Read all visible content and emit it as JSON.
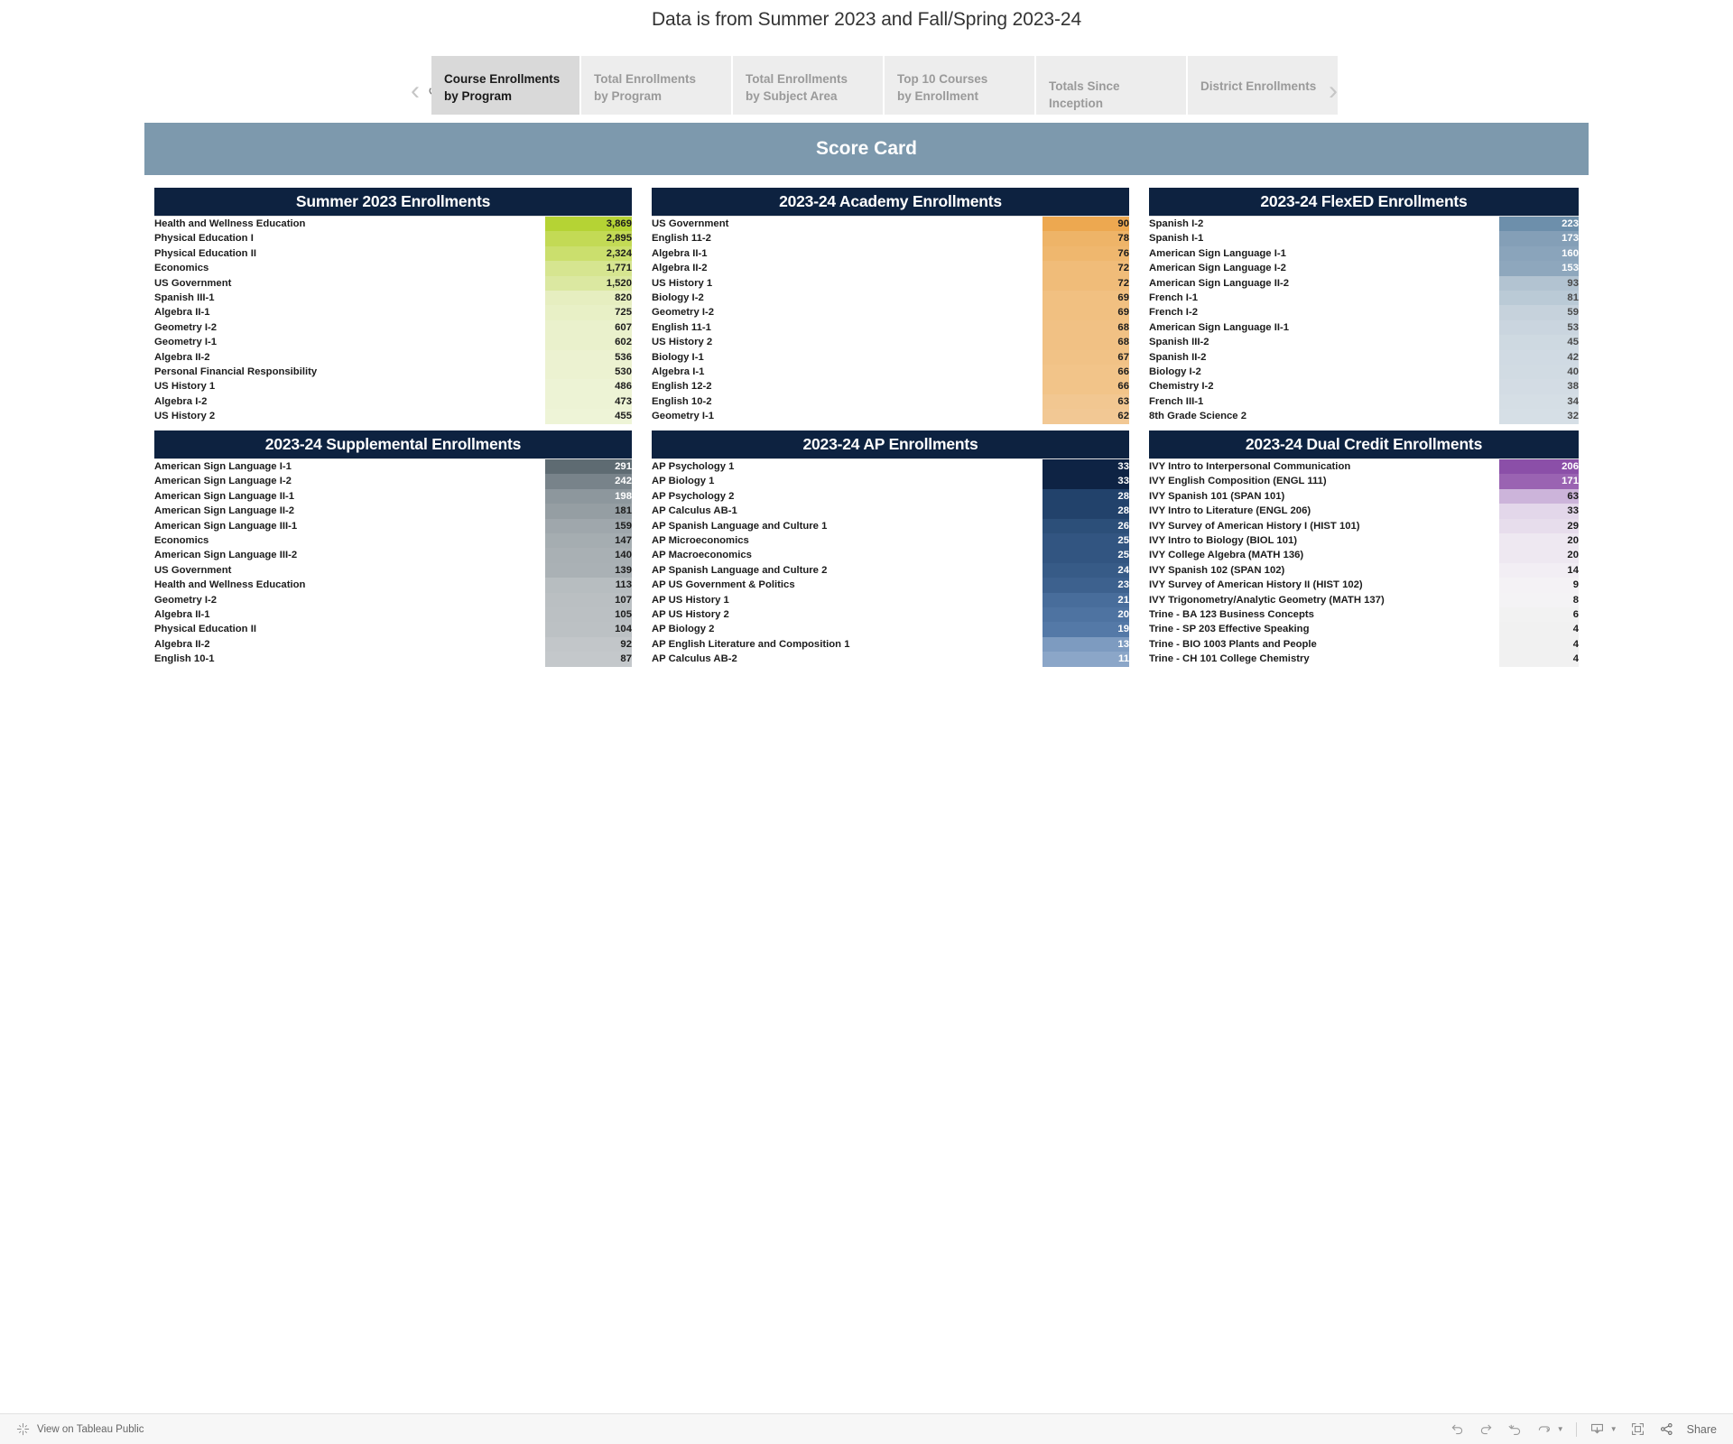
{
  "page": {
    "title": "Data is from Summer 2023 and Fall/Spring 2023-24",
    "scorecard_banner": "Score Card"
  },
  "tabs": {
    "prev_label": "‹",
    "next_label": "›",
    "revert_label": "↺",
    "items": [
      {
        "label": "Course Enrollments\nby Program",
        "active": true
      },
      {
        "label": "Total Enrollments\nby Program",
        "active": false
      },
      {
        "label": "Total Enrollments\nby Subject Area",
        "active": false
      },
      {
        "label": "Top 10 Courses\nby Enrollment",
        "active": false
      },
      {
        "label": "Totals Since Inception",
        "active": false
      },
      {
        "label": "District Enrollments",
        "active": false
      }
    ]
  },
  "colors": {
    "header_navy": "#0d2240",
    "banner_blue": "#7d99ad",
    "green_accent": "#b5d334",
    "orange_accent": "#eda850",
    "steel_blue_accent": "#6d8fab",
    "gray_accent": "#5e6b72",
    "ap_blue_accent": "#0e2344",
    "purple_accent": "#8b4fa8"
  },
  "panels": [
    {
      "title": "Summer 2023 Enrollments",
      "scheme": "green",
      "rows": [
        {
          "label": "Health and Wellness Education",
          "value": "3,869",
          "n": 3869,
          "color": "#b5d334",
          "text": "#1c1c1c"
        },
        {
          "label": "Physical Education I",
          "value": "2,895",
          "n": 2895,
          "color": "#c3da55",
          "text": "#1c1c1c"
        },
        {
          "label": "Physical Education II",
          "value": "2,324",
          "n": 2324,
          "color": "#cbdf6d",
          "text": "#1c1c1c"
        },
        {
          "label": "Economics",
          "value": "1,771",
          "n": 1771,
          "color": "#d6e590",
          "text": "#1c1c1c"
        },
        {
          "label": "US Government",
          "value": "1,520",
          "n": 1520,
          "color": "#dbe8a1",
          "text": "#1c1c1c"
        },
        {
          "label": "Spanish III-1",
          "value": "820",
          "n": 820,
          "color": "#e6eec0",
          "text": "#1c1c1c"
        },
        {
          "label": "Algebra II-1",
          "value": "725",
          "n": 725,
          "color": "#e8f0c6",
          "text": "#1c1c1c"
        },
        {
          "label": "Geometry I-2",
          "value": "607",
          "n": 607,
          "color": "#eaf1cc",
          "text": "#1c1c1c"
        },
        {
          "label": "Geometry I-1",
          "value": "602",
          "n": 602,
          "color": "#eaf1cc",
          "text": "#1c1c1c"
        },
        {
          "label": "Algebra II-2",
          "value": "536",
          "n": 536,
          "color": "#ecf2d1",
          "text": "#1c1c1c"
        },
        {
          "label": "Personal Financial Responsibility",
          "value": "530",
          "n": 530,
          "color": "#ecf2d1",
          "text": "#1c1c1c"
        },
        {
          "label": "US History 1",
          "value": "486",
          "n": 486,
          "color": "#edf3d5",
          "text": "#1c1c1c"
        },
        {
          "label": "Algebra I-2",
          "value": "473",
          "n": 473,
          "color": "#edf3d5",
          "text": "#1c1c1c"
        },
        {
          "label": "US History 2",
          "value": "455",
          "n": 455,
          "color": "#eef4d7",
          "text": "#1c1c1c"
        }
      ]
    },
    {
      "title": "2023-24 Academy Enrollments",
      "scheme": "orange",
      "rows": [
        {
          "label": "US Government",
          "value": "90",
          "n": 90,
          "color": "#eda850",
          "text": "#1c1c1c"
        },
        {
          "label": "English 11-2",
          "value": "78",
          "n": 78,
          "color": "#eeb468",
          "text": "#1c1c1c"
        },
        {
          "label": "Algebra II-1",
          "value": "76",
          "n": 76,
          "color": "#efb76e",
          "text": "#1c1c1c"
        },
        {
          "label": "Algebra II-2",
          "value": "72",
          "n": 72,
          "color": "#f0bc79",
          "text": "#1c1c1c"
        },
        {
          "label": "US History 1",
          "value": "72",
          "n": 72,
          "color": "#f0bc79",
          "text": "#1c1c1c"
        },
        {
          "label": "Biology I-2",
          "value": "69",
          "n": 69,
          "color": "#f1c081",
          "text": "#1c1c1c"
        },
        {
          "label": "Geometry I-2",
          "value": "69",
          "n": 69,
          "color": "#f1c081",
          "text": "#1c1c1c"
        },
        {
          "label": "English 11-1",
          "value": "68",
          "n": 68,
          "color": "#f1c184",
          "text": "#1c1c1c"
        },
        {
          "label": "US History 2",
          "value": "68",
          "n": 68,
          "color": "#f1c184",
          "text": "#1c1c1c"
        },
        {
          "label": "Biology I-1",
          "value": "67",
          "n": 67,
          "color": "#f1c286",
          "text": "#1c1c1c"
        },
        {
          "label": "Algebra I-1",
          "value": "66",
          "n": 66,
          "color": "#f2c489",
          "text": "#1c1c1c"
        },
        {
          "label": "English 12-2",
          "value": "66",
          "n": 66,
          "color": "#f2c489",
          "text": "#1c1c1c"
        },
        {
          "label": "English 10-2",
          "value": "63",
          "n": 63,
          "color": "#f2c791",
          "text": "#1c1c1c"
        },
        {
          "label": "Geometry I-1",
          "value": "62",
          "n": 62,
          "color": "#f2c894",
          "text": "#1c1c1c"
        }
      ]
    },
    {
      "title": "2023-24 FlexED Enrollments",
      "scheme": "steelblue",
      "rows": [
        {
          "label": "Spanish I-2",
          "value": "223",
          "n": 223,
          "color": "#6d8fab",
          "text": "#ffffff"
        },
        {
          "label": "Spanish I-1",
          "value": "173",
          "n": 173,
          "color": "#849fb7",
          "text": "#ffffff"
        },
        {
          "label": "American Sign Language I-1",
          "value": "160",
          "n": 160,
          "color": "#8aa4bb",
          "text": "#ffffff"
        },
        {
          "label": "American Sign Language I-2",
          "value": "153",
          "n": 153,
          "color": "#8ea7bd",
          "text": "#ffffff"
        },
        {
          "label": "American Sign Language II-2",
          "value": "93",
          "n": 93,
          "color": "#b2c3d1",
          "text": "#4a4a4a"
        },
        {
          "label": "French I-1",
          "value": "81",
          "n": 81,
          "color": "#bacad6",
          "text": "#4a4a4a"
        },
        {
          "label": "French I-2",
          "value": "59",
          "n": 59,
          "color": "#c6d2dc",
          "text": "#4a4a4a"
        },
        {
          "label": "American Sign Language II-1",
          "value": "53",
          "n": 53,
          "color": "#cad5df",
          "text": "#4a4a4a"
        },
        {
          "label": "Spanish III-2",
          "value": "45",
          "n": 45,
          "color": "#ced9e1",
          "text": "#4a4a4a"
        },
        {
          "label": "Spanish II-2",
          "value": "42",
          "n": 42,
          "color": "#d0dae3",
          "text": "#4a4a4a"
        },
        {
          "label": "Biology I-2",
          "value": "40",
          "n": 40,
          "color": "#d1dbe3",
          "text": "#4a4a4a"
        },
        {
          "label": "Chemistry I-2",
          "value": "38",
          "n": 38,
          "color": "#d3dce4",
          "text": "#4a4a4a"
        },
        {
          "label": "French III-1",
          "value": "34",
          "n": 34,
          "color": "#d5dee5",
          "text": "#4a4a4a"
        },
        {
          "label": "8th Grade Science 2",
          "value": "32",
          "n": 32,
          "color": "#d6dfe6",
          "text": "#4a4a4a"
        }
      ]
    },
    {
      "title": "2023-24 Supplemental Enrollments",
      "scheme": "gray",
      "rows": [
        {
          "label": "American Sign Language I-1",
          "value": "291",
          "n": 291,
          "color": "#5e6b72",
          "text": "#ffffff"
        },
        {
          "label": "American Sign Language I-2",
          "value": "242",
          "n": 242,
          "color": "#78838a",
          "text": "#ffffff"
        },
        {
          "label": "American Sign Language II-1",
          "value": "198",
          "n": 198,
          "color": "#8d979d",
          "text": "#ffffff"
        },
        {
          "label": "American Sign Language II-2",
          "value": "181",
          "n": 181,
          "color": "#959ea3",
          "text": "#1c1c1c"
        },
        {
          "label": "American Sign Language III-1",
          "value": "159",
          "n": 159,
          "color": "#9fa7ac",
          "text": "#1c1c1c"
        },
        {
          "label": "Economics",
          "value": "147",
          "n": 147,
          "color": "#a5adb1",
          "text": "#1c1c1c"
        },
        {
          "label": "American Sign Language III-2",
          "value": "140",
          "n": 140,
          "color": "#a9b0b4",
          "text": "#1c1c1c"
        },
        {
          "label": "US Government",
          "value": "139",
          "n": 139,
          "color": "#aab1b5",
          "text": "#1c1c1c"
        },
        {
          "label": "Health and Wellness Education",
          "value": "113",
          "n": 113,
          "color": "#b7bdc0",
          "text": "#1c1c1c"
        },
        {
          "label": "Geometry I-2",
          "value": "107",
          "n": 107,
          "color": "#babfc2",
          "text": "#1c1c1c"
        },
        {
          "label": "Algebra II-1",
          "value": "105",
          "n": 105,
          "color": "#bbc0c3",
          "text": "#1c1c1c"
        },
        {
          "label": "Physical Education II",
          "value": "104",
          "n": 104,
          "color": "#bcc1c4",
          "text": "#1c1c1c"
        },
        {
          "label": "Algebra II-2",
          "value": "92",
          "n": 92,
          "color": "#c2c6c9",
          "text": "#1c1c1c"
        },
        {
          "label": "English 10-1",
          "value": "87",
          "n": 87,
          "color": "#c4c8cb",
          "text": "#1c1c1c"
        }
      ]
    },
    {
      "title": "2023-24 AP Enrollments",
      "scheme": "apblue",
      "rows": [
        {
          "label": "AP Psychology 1",
          "value": "33",
          "n": 33,
          "color": "#0e2344",
          "text": "#ffffff"
        },
        {
          "label": "AP Biology 1",
          "value": "33",
          "n": 33,
          "color": "#0e2344",
          "text": "#ffffff"
        },
        {
          "label": "AP Psychology 2",
          "value": "28",
          "n": 28,
          "color": "#22426b",
          "text": "#ffffff"
        },
        {
          "label": "AP Calculus AB-1",
          "value": "28",
          "n": 28,
          "color": "#22426b",
          "text": "#ffffff"
        },
        {
          "label": "AP Spanish Language and Culture 1",
          "value": "26",
          "n": 26,
          "color": "#2c4f79",
          "text": "#ffffff"
        },
        {
          "label": "AP Microeconomics",
          "value": "25",
          "n": 25,
          "color": "#325581",
          "text": "#ffffff"
        },
        {
          "label": "AP Macroeconomics",
          "value": "25",
          "n": 25,
          "color": "#325581",
          "text": "#ffffff"
        },
        {
          "label": "AP Spanish Language and Culture 2",
          "value": "24",
          "n": 24,
          "color": "#375b87",
          "text": "#ffffff"
        },
        {
          "label": "AP US Government & Politics",
          "value": "23",
          "n": 23,
          "color": "#3d618e",
          "text": "#ffffff"
        },
        {
          "label": "AP US History 1",
          "value": "21",
          "n": 21,
          "color": "#486d9b",
          "text": "#ffffff"
        },
        {
          "label": "AP US History 2",
          "value": "20",
          "n": 20,
          "color": "#4e73a1",
          "text": "#ffffff"
        },
        {
          "label": "AP Biology 2",
          "value": "19",
          "n": 19,
          "color": "#5479a7",
          "text": "#ffffff"
        },
        {
          "label": "AP English Literature and Composition 1",
          "value": "13",
          "n": 13,
          "color": "#7d9bc0",
          "text": "#ffffff"
        },
        {
          "label": "AP Calculus AB-2",
          "value": "11",
          "n": 11,
          "color": "#8ba6c8",
          "text": "#ffffff"
        }
      ]
    },
    {
      "title": "2023-24 Dual Credit Enrollments",
      "scheme": "purple",
      "rows": [
        {
          "label": "IVY Intro to Interpersonal Communication",
          "value": "206",
          "n": 206,
          "color": "#8b4fa8",
          "text": "#ffffff"
        },
        {
          "label": "IVY English Composition (ENGL 111)",
          "value": "171",
          "n": 171,
          "color": "#9a63b2",
          "text": "#ffffff"
        },
        {
          "label": "IVY Spanish 101 (SPAN 101)",
          "value": "63",
          "n": 63,
          "color": "#ccb4da",
          "text": "#1c1c1c"
        },
        {
          "label": "IVY Intro to Literature (ENGL 206)",
          "value": "33",
          "n": 33,
          "color": "#e3d7ea",
          "text": "#1c1c1c"
        },
        {
          "label": "IVY Survey of American History I (HIST 101)",
          "value": "29",
          "n": 29,
          "color": "#e7ddec",
          "text": "#1c1c1c"
        },
        {
          "label": "IVY Intro to Biology (BIOL 101)",
          "value": "20",
          "n": 20,
          "color": "#eee8f1",
          "text": "#1c1c1c"
        },
        {
          "label": "IVY College Algebra (MATH 136)",
          "value": "20",
          "n": 20,
          "color": "#eee8f1",
          "text": "#1c1c1c"
        },
        {
          "label": "IVY Spanish 102 (SPAN 102)",
          "value": "14",
          "n": 14,
          "color": "#f2eef4",
          "text": "#1c1c1c"
        },
        {
          "label": "IVY Survey of American History II (HIST 102)",
          "value": "9",
          "n": 9,
          "color": "#f4f2f5",
          "text": "#1c1c1c"
        },
        {
          "label": "IVY Trigonometry/Analytic Geometry (MATH 137)",
          "value": "8",
          "n": 8,
          "color": "#f4f3f5",
          "text": "#1c1c1c"
        },
        {
          "label": "Trine - BA 123 Business Concepts",
          "value": "6",
          "n": 6,
          "color": "#f2f2f2",
          "text": "#1c1c1c"
        },
        {
          "label": "Trine - SP 203 Effective Speaking",
          "value": "4",
          "n": 4,
          "color": "#f1f1f1",
          "text": "#1c1c1c"
        },
        {
          "label": "Trine - BIO 1003 Plants and People",
          "value": "4",
          "n": 4,
          "color": "#f1f1f1",
          "text": "#1c1c1c"
        },
        {
          "label": "Trine - CH 101 College Chemistry",
          "value": "4",
          "n": 4,
          "color": "#f1f1f1",
          "text": "#1c1c1c"
        }
      ]
    }
  ],
  "toolbar": {
    "view_on_tableau": "View on Tableau Public",
    "share_label": "Share",
    "icons": [
      "undo-icon",
      "redo-icon",
      "revert-icon",
      "refresh-icon",
      "caret-down-icon",
      "download-icon",
      "caret-down-icon",
      "fullscreen-icon",
      "share-icon"
    ]
  }
}
